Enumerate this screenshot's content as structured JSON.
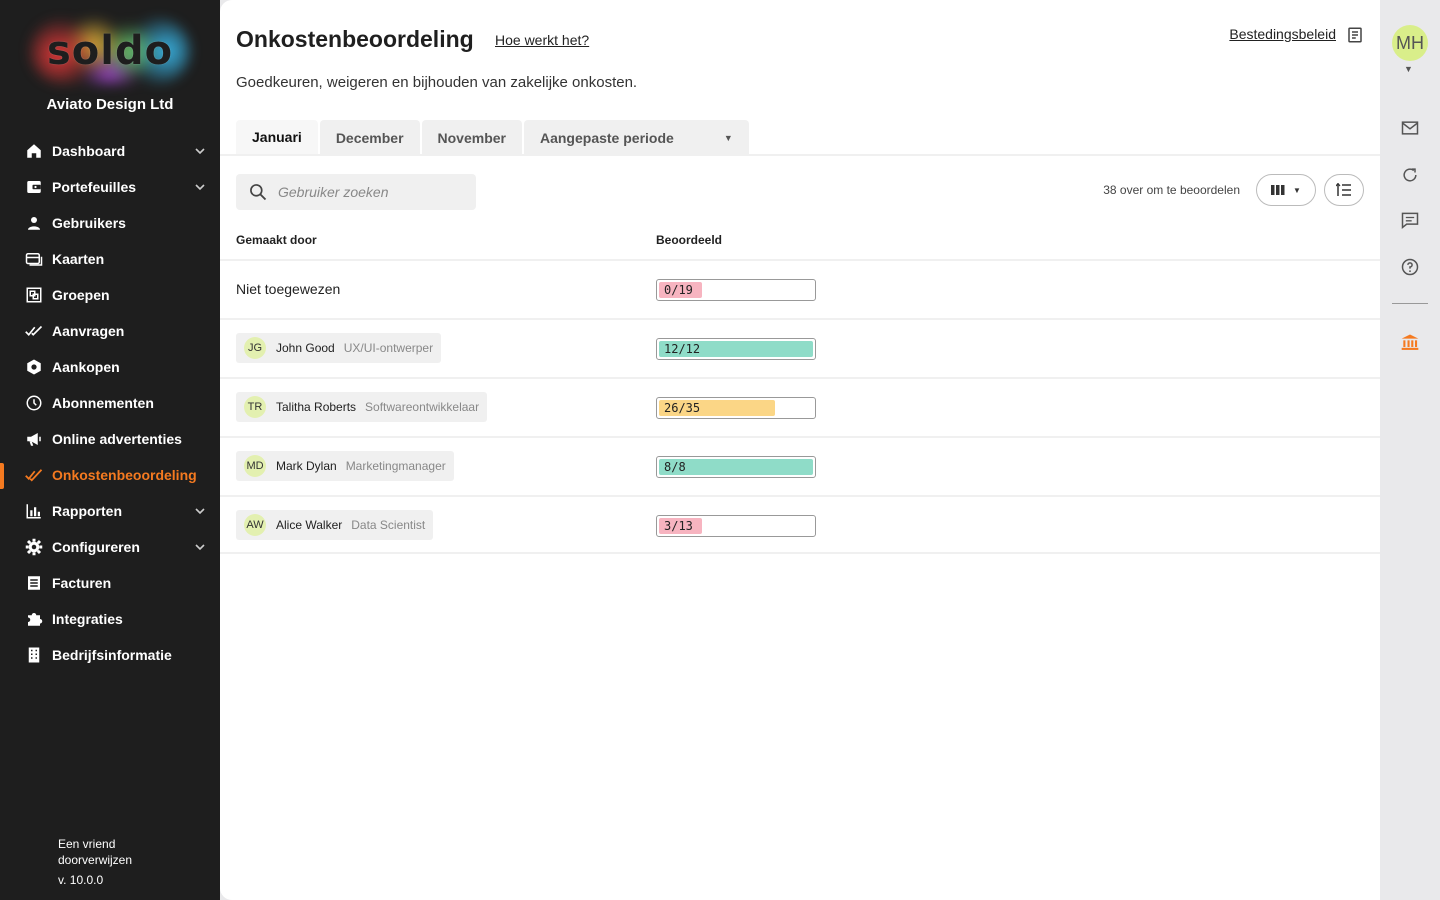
{
  "brand": {
    "logo_text": "soldo",
    "company": "Aviato Design Ltd",
    "accent_color": "#f57a20"
  },
  "sidebar": {
    "items": [
      {
        "label": "Dashboard",
        "icon": "home-icon",
        "chevron": true
      },
      {
        "label": "Portefeuilles",
        "icon": "wallet-icon",
        "chevron": true
      },
      {
        "label": "Gebruikers",
        "icon": "user-icon",
        "chevron": false
      },
      {
        "label": "Kaarten",
        "icon": "cards-icon",
        "chevron": false
      },
      {
        "label": "Groepen",
        "icon": "groups-icon",
        "chevron": false
      },
      {
        "label": "Aanvragen",
        "icon": "double-check-icon",
        "chevron": false
      },
      {
        "label": "Aankopen",
        "icon": "purchases-icon",
        "chevron": false
      },
      {
        "label": "Abonnementen",
        "icon": "clock-icon",
        "chevron": false
      },
      {
        "label": "Online advertenties",
        "icon": "megaphone-icon",
        "chevron": false
      },
      {
        "label": "Onkostenbeoordeling",
        "icon": "review-check-icon",
        "chevron": false,
        "active": true
      },
      {
        "label": "Rapporten",
        "icon": "bar-chart-icon",
        "chevron": true
      },
      {
        "label": "Configureren",
        "icon": "gear-icon",
        "chevron": true
      },
      {
        "label": "Facturen",
        "icon": "invoice-icon",
        "chevron": false
      },
      {
        "label": "Integraties",
        "icon": "puzzle-icon",
        "chevron": false
      },
      {
        "label": "Bedrijfsinformatie",
        "icon": "building-icon",
        "chevron": false
      }
    ],
    "footer": {
      "refer": "Een vriend doorverwijzen",
      "version": "v. 10.0.0"
    }
  },
  "header": {
    "title": "Onkostenbeoordeling",
    "help_link": "Hoe werkt het?",
    "policy_link": "Bestedingsbeleid",
    "subtitle": "Goedkeuren, weigeren en bijhouden van zakelijke onkosten."
  },
  "tabs": [
    {
      "label": "Januari",
      "active": true
    },
    {
      "label": "December"
    },
    {
      "label": "November"
    },
    {
      "label": "Aangepaste periode",
      "dropdown": true
    }
  ],
  "toolbar": {
    "search_placeholder": "Gebruiker zoeken",
    "remaining_text": "38 over om te beoordelen"
  },
  "table": {
    "headers": {
      "created_by": "Gemaakt door",
      "reviewed": "Beoordeeld"
    },
    "rows": [
      {
        "unassigned": true,
        "name": "Niet toegewezen",
        "reviewed": "0/19",
        "fraction": 0.28,
        "color": "#f7b4c0"
      },
      {
        "initials": "JG",
        "name": "John Good",
        "role": "UX/UI-ontwerper",
        "reviewed": "12/12",
        "fraction": 1.0,
        "color": "#8fdcc8"
      },
      {
        "initials": "TR",
        "name": "Talitha Roberts",
        "role": "Softwareontwikkelaar",
        "reviewed": "26/35",
        "fraction": 0.75,
        "color": "#fbd686"
      },
      {
        "initials": "MD",
        "name": "Mark Dylan",
        "role": "Marketingmanager",
        "reviewed": "8/8",
        "fraction": 1.0,
        "color": "#8fdcc8"
      },
      {
        "initials": "AW",
        "name": "Alice Walker",
        "role": "Data Scientist",
        "reviewed": "3/13",
        "fraction": 0.28,
        "color": "#f7b4c0"
      }
    ]
  },
  "account": {
    "initials": "MH"
  }
}
